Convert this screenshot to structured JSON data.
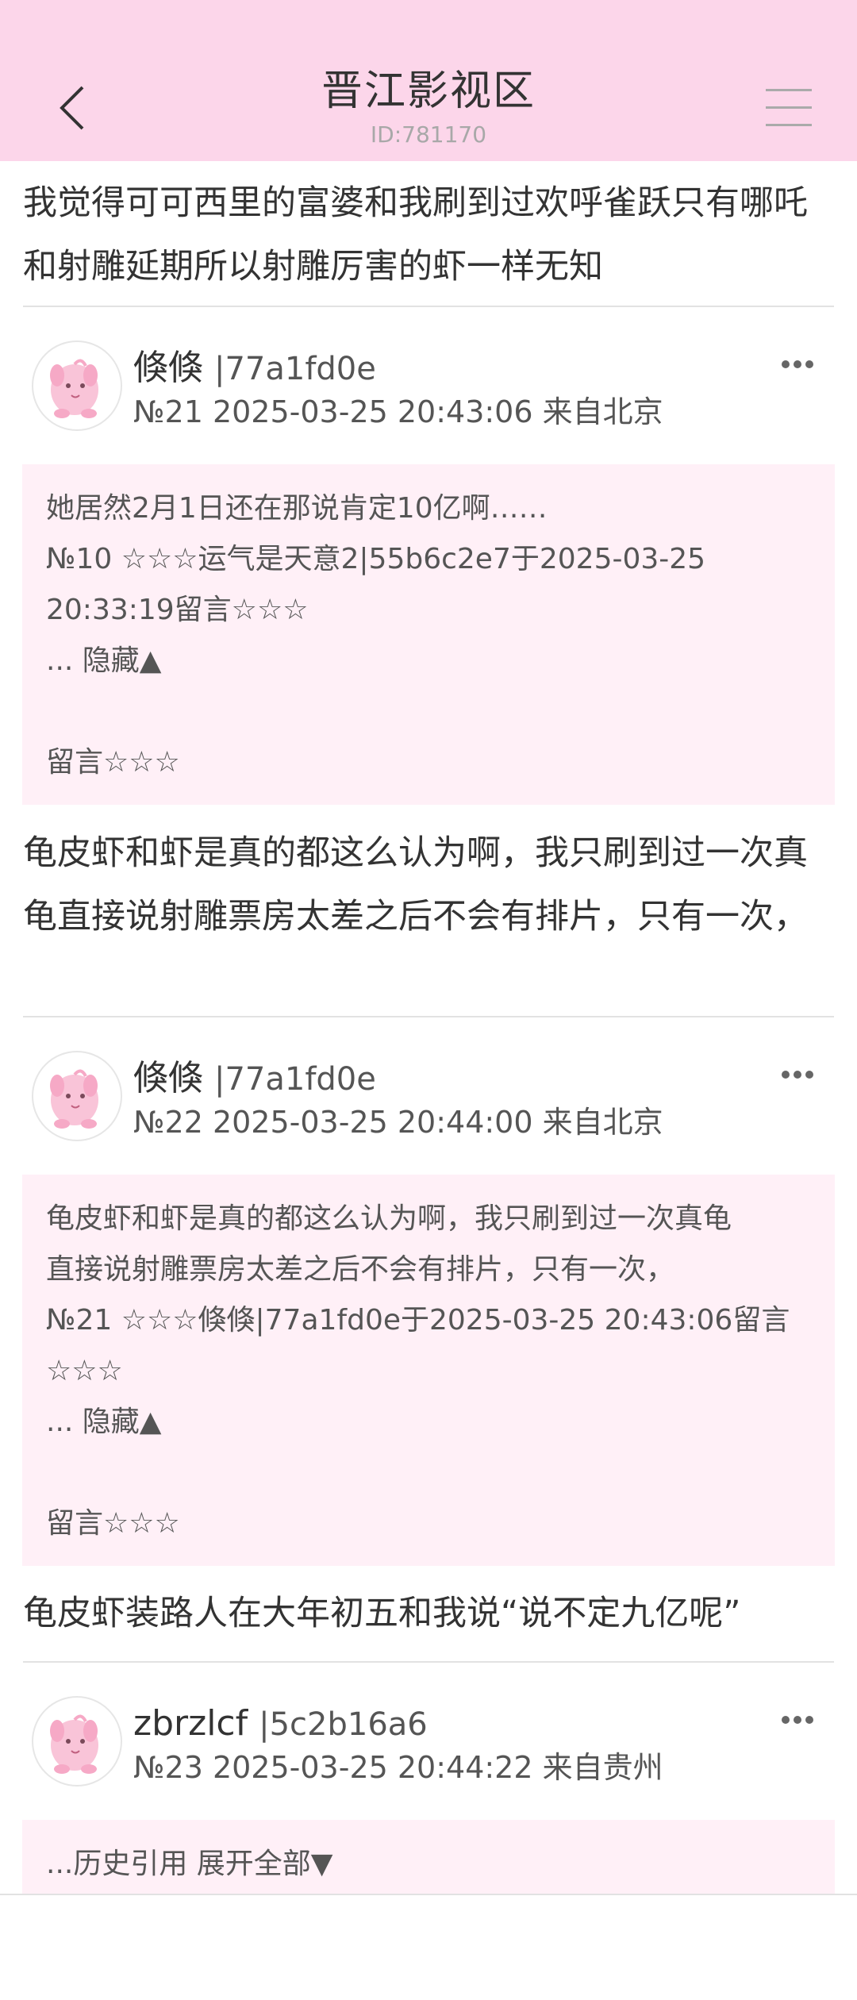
{
  "header": {
    "title": "晋江影视区",
    "subtitle": "ID:781170",
    "back_icon": "chevron-left-icon",
    "menu_icon": "hamburger-menu-icon"
  },
  "messages": [
    {
      "text": "我觉得可可西里的富婆和我刷到过欢呼雀跃只有哪吒和射雕延期所以射雕厉害的虾一样无知"
    }
  ],
  "posts": [
    {
      "name": "倏倏",
      "uid": "|77a1fd0e",
      "meta": "№21 2025-03-25 20:43:06 来自北京",
      "quote": [
        "她居然2月1日还在那说肯定10亿啊……",
        "№10 ☆☆☆运气是天意2|55b6c2e7于2025-03-25",
        "20:33:19留言☆☆☆",
        "... 隐藏▲",
        "",
        "留言☆☆☆"
      ],
      "text": "龟皮虾和虾是真的都这么认为啊，我只刷到过一次真龟直接说射雕票房太差之后不会有排片，只有一次，"
    },
    {
      "name": "倏倏",
      "uid": "|77a1fd0e",
      "meta": "№22 2025-03-25 20:44:00 来自北京",
      "quote": [
        "龟皮虾和虾是真的都这么认为啊，我只刷到过一次真龟",
        "直接说射雕票房太差之后不会有排片，只有一次，",
        "№21 ☆☆☆倏倏|77a1fd0e于2025-03-25 20:43:06留言",
        "☆☆☆",
        "... 隐藏▲",
        "",
        "留言☆☆☆"
      ],
      "text": "龟皮虾装路人在大年初五和我说“说不定九亿呢”"
    },
    {
      "name": "zbrzlcf",
      "uid": "|5c2b16a6",
      "meta": "№23 2025-03-25 20:44:22 来自贵州",
      "quote": [
        "...历史引用 展开全部▼"
      ]
    }
  ],
  "colors": {
    "header_bg": "#fcd6ea",
    "quote_bg": "#fff0f7",
    "text": "#333333",
    "meta": "#555555"
  }
}
